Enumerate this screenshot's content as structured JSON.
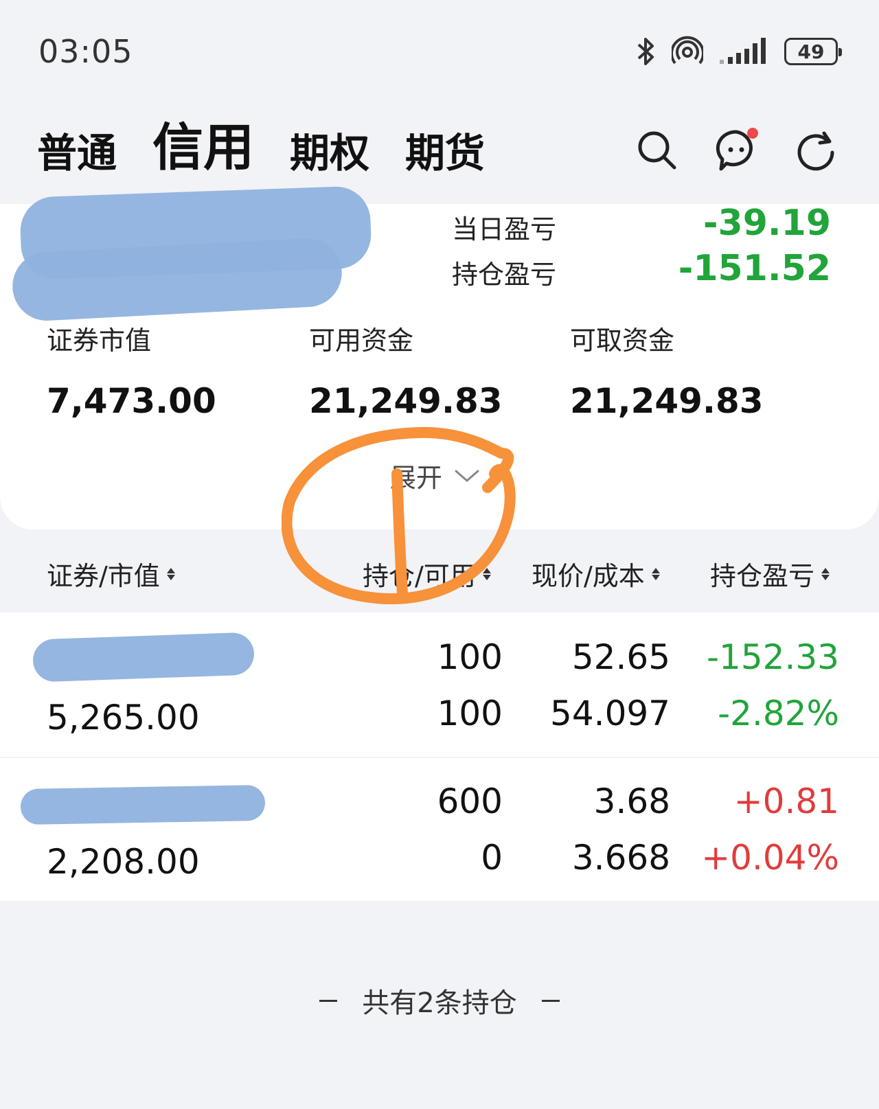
{
  "status_bar": {
    "time": "03:05",
    "battery": "49"
  },
  "tabs": [
    {
      "label": "普通",
      "active": false
    },
    {
      "label": "信用",
      "active": true
    },
    {
      "label": "期权",
      "active": false
    },
    {
      "label": "期货",
      "active": false
    }
  ],
  "account": {
    "daily_pl_label": "当日盈亏",
    "daily_pl_value": "-39.19",
    "position_pl_label": "持仓盈亏",
    "position_pl_value": "-151.52",
    "market_value_label": "证券市值",
    "market_value": "7,473.00",
    "available_funds_label": "可用资金",
    "available_funds": "21,249.83",
    "withdrawable_label": "可取资金",
    "withdrawable": "21,249.83",
    "expand_label": "展开"
  },
  "list_header": {
    "col1": "证券/市值",
    "col2": "持仓/可用",
    "col3": "现价/成本",
    "col4": "持仓盈亏"
  },
  "positions": [
    {
      "market_value": "5,265.00",
      "holding": "100",
      "available": "100",
      "price": "52.65",
      "cost": "54.097",
      "pl": "-152.33",
      "pl_pct": "-2.82%"
    },
    {
      "market_value": "2,208.00",
      "holding": "600",
      "available": "0",
      "price": "3.68",
      "cost": "3.668",
      "pl": "+0.81",
      "pl_pct": "+0.04%"
    }
  ],
  "footer": {
    "text": "共有2条持仓"
  },
  "colors": {
    "gain": "#e03c3c",
    "loss": "#21a43a",
    "annotation": "#f7913a",
    "redaction": "#8fb2de"
  }
}
